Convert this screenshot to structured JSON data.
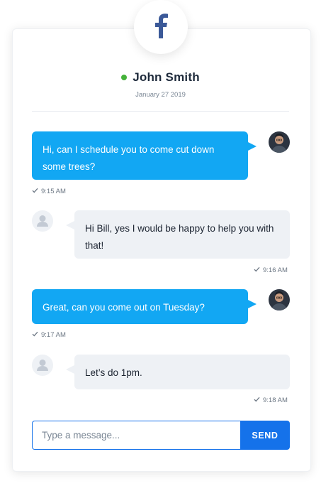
{
  "brand": {
    "icon": "facebook-icon",
    "color": "#3b5998"
  },
  "contact": {
    "name": "John Smith",
    "status": "online",
    "status_color": "#45b23a",
    "date": "January 27 2019"
  },
  "messages": [
    {
      "direction": "outgoing",
      "text": "Hi, can I schedule you to come cut down some trees?",
      "time": "9:15 AM",
      "avatar": "user-photo-avatar"
    },
    {
      "direction": "incoming",
      "text": "Hi Bill, yes I would be happy to help you with that!",
      "time": "9:16 AM",
      "avatar": "placeholder-person-icon"
    },
    {
      "direction": "outgoing",
      "text": "Great, can you come out on Tuesday?",
      "time": "9:17 AM",
      "avatar": "user-photo-avatar"
    },
    {
      "direction": "incoming",
      "text": "Let’s do 1pm.",
      "time": "9:18 AM",
      "avatar": "placeholder-person-icon"
    }
  ],
  "composer": {
    "placeholder": "Type a message...",
    "value": "",
    "send_label": "SEND"
  },
  "colors": {
    "outgoing_bubble": "#12a7f3",
    "incoming_bubble": "#eef1f5",
    "accent": "#1572ea"
  }
}
